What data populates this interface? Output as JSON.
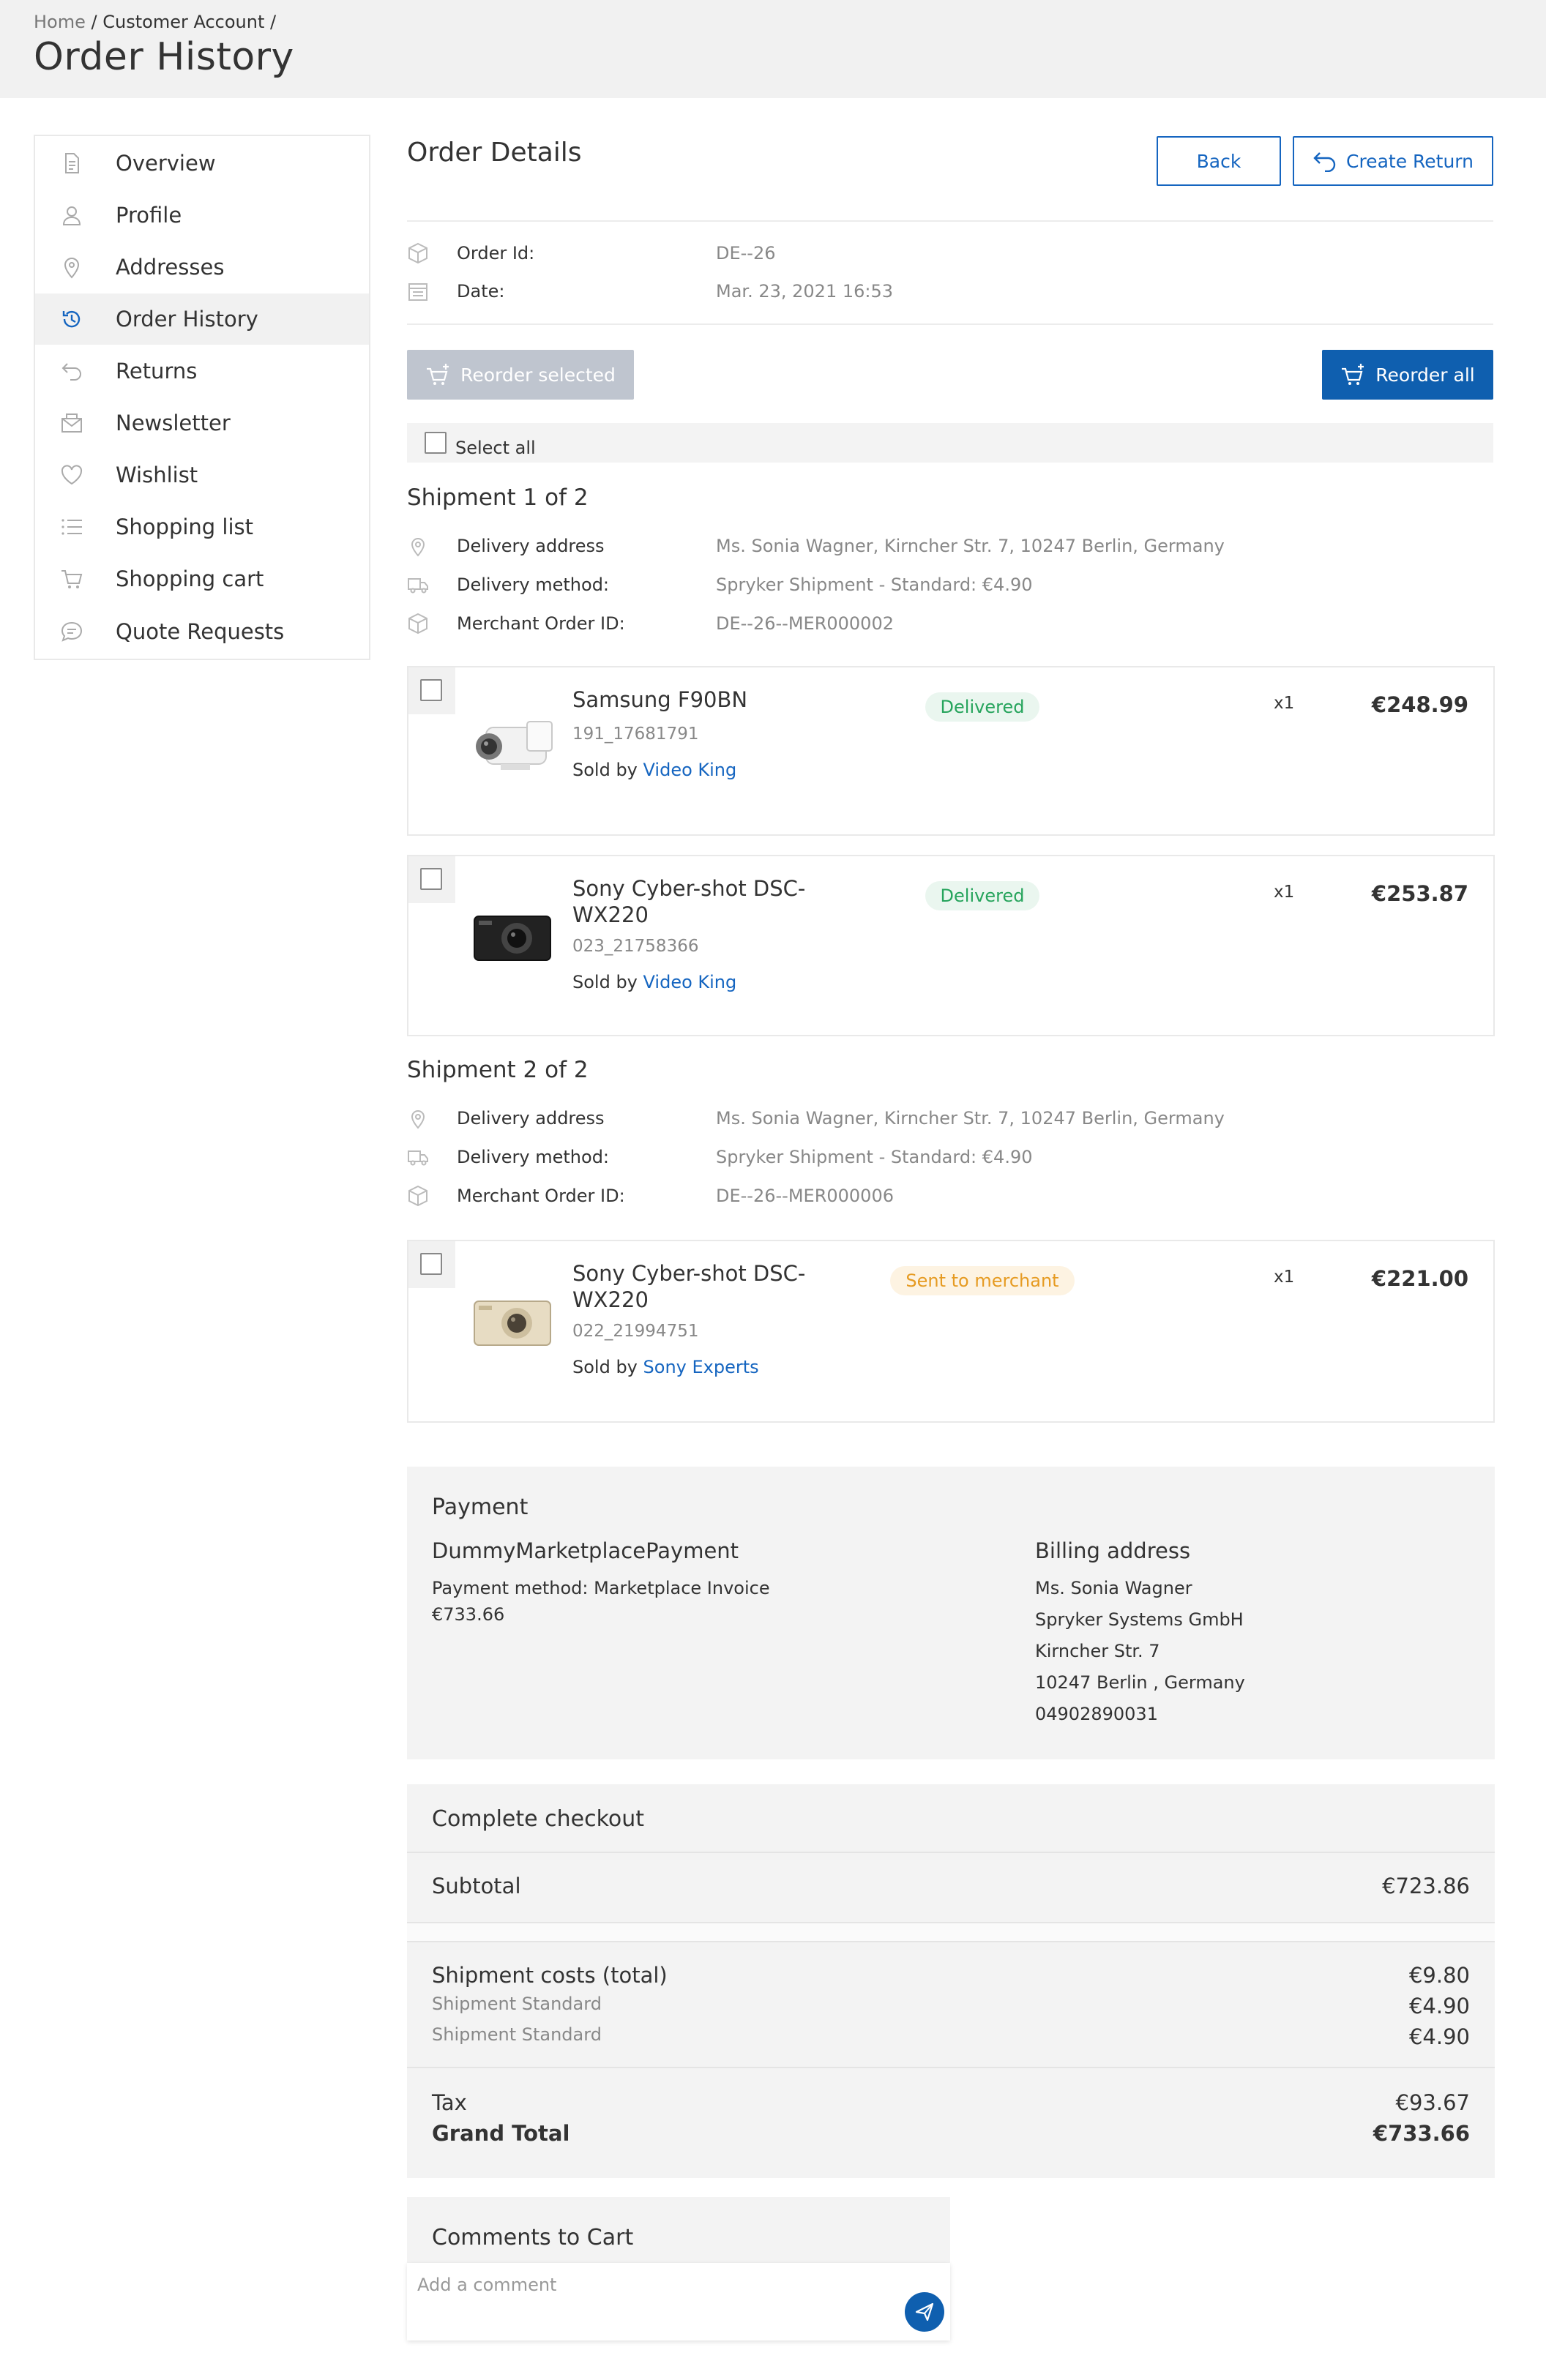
{
  "breadcrumb": {
    "home": "Home",
    "sep1": "/",
    "account": "Customer Account",
    "sep2": "/"
  },
  "page_title": "Order History",
  "sidebar": {
    "items": [
      {
        "label": "Overview",
        "icon": "document-icon"
      },
      {
        "label": "Profile",
        "icon": "user-icon"
      },
      {
        "label": "Addresses",
        "icon": "map-pin-icon"
      },
      {
        "label": "Order History",
        "icon": "history-icon",
        "active": true
      },
      {
        "label": "Returns",
        "icon": "return-icon"
      },
      {
        "label": "Newsletter",
        "icon": "envelope-icon"
      },
      {
        "label": "Wishlist",
        "icon": "heart-icon"
      },
      {
        "label": "Shopping list",
        "icon": "list-icon"
      },
      {
        "label": "Shopping cart",
        "icon": "cart-icon"
      },
      {
        "label": "Quote Requests",
        "icon": "chat-icon"
      }
    ]
  },
  "order": {
    "title": "Order Details",
    "back_label": "Back",
    "create_return_label": "Create Return",
    "id_label": "Order Id:",
    "id_value": "DE--26",
    "date_label": "Date:",
    "date_value": "Mar. 23, 2021 16:53",
    "reorder_selected_label": "Reorder selected",
    "reorder_all_label": "Reorder all",
    "select_all_label": "Select all"
  },
  "shipments": [
    {
      "title": "Shipment 1 of 2",
      "address_label": "Delivery address",
      "address_value": "Ms. Sonia Wagner, Kirncher Str. 7, 10247 Berlin, Germany",
      "method_label": "Delivery method:",
      "method_value": "Spryker Shipment - Standard: €4.90",
      "merchant_label": "Merchant Order ID:",
      "merchant_value": "DE--26--MER000002",
      "items": [
        {
          "name": "Samsung F90BN",
          "sku": "191_17681791",
          "sold_by_label": "Sold by",
          "merchant": "Video King",
          "status": "Delivered",
          "qty": "x1",
          "price": "€248.99"
        },
        {
          "name": "Sony Cyber-shot DSC-WX220",
          "sku": "023_21758366",
          "sold_by_label": "Sold by",
          "merchant": "Video King",
          "status": "Delivered",
          "qty": "x1",
          "price": "€253.87"
        }
      ]
    },
    {
      "title": "Shipment 2 of 2",
      "address_label": "Delivery address",
      "address_value": "Ms. Sonia Wagner, Kirncher Str. 7, 10247 Berlin, Germany",
      "method_label": "Delivery method:",
      "method_value": "Spryker Shipment - Standard: €4.90",
      "merchant_label": "Merchant Order ID:",
      "merchant_value": "DE--26--MER000006",
      "items": [
        {
          "name": "Sony Cyber-shot DSC-WX220",
          "sku": "022_21994751",
          "sold_by_label": "Sold by",
          "merchant": "Sony Experts",
          "status": "Sent to merchant",
          "qty": "x1",
          "price": "€221.00"
        }
      ]
    }
  ],
  "payment": {
    "title": "Payment",
    "provider": "DummyMarketplacePayment",
    "method": "Payment method: Marketplace Invoice",
    "amount": "€733.66",
    "billing_title": "Billing address",
    "billing_lines": [
      "Ms. Sonia Wagner",
      "Spryker Systems GmbH",
      "Kirncher Str. 7",
      "10247 Berlin , Germany",
      "04902890031"
    ]
  },
  "checkout": {
    "title": "Complete checkout",
    "subtotal_label": "Subtotal",
    "subtotal_value": "€723.86",
    "shipment_label": "Shipment costs (total)",
    "shipment_value": "€9.80",
    "shipment_lines": [
      {
        "label": "Shipment Standard",
        "value": "€4.90"
      },
      {
        "label": "Shipment Standard",
        "value": "€4.90"
      }
    ],
    "tax_label": "Tax",
    "tax_value": "€93.67",
    "grand_total_label": "Grand Total",
    "grand_total_value": "€733.66"
  },
  "comments": {
    "title": "Comments to Cart",
    "placeholder": "Add a comment"
  },
  "colors": {
    "primary": "#0f5faf",
    "link": "#1565c0",
    "delivered": "#26a45c",
    "sent": "#e69b22"
  }
}
